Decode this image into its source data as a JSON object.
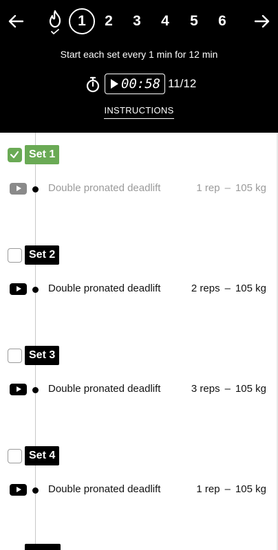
{
  "header": {
    "steps": [
      "1",
      "2",
      "3",
      "4",
      "5",
      "6"
    ],
    "active_step": "1",
    "subtitle": "Start each set every 1 min for 12 min",
    "timer": "00:58",
    "round_count": "11/12",
    "instructions_label": "INSTRUCTIONS"
  },
  "sets": [
    {
      "label": "Set 1",
      "completed": true,
      "exercise": "Double pronated deadlift",
      "reps": "1 rep",
      "weight": "105 kg"
    },
    {
      "label": "Set 2",
      "completed": false,
      "exercise": "Double pronated deadlift",
      "reps": "2 reps",
      "weight": "105 kg"
    },
    {
      "label": "Set 3",
      "completed": false,
      "exercise": "Double pronated deadlift",
      "reps": "3 reps",
      "weight": "105 kg"
    },
    {
      "label": "Set 4",
      "completed": false,
      "exercise": "Double pronated deadlift",
      "reps": "1 rep",
      "weight": "105 kg"
    }
  ],
  "separator": "–",
  "colors": {
    "header_bg": "#000000",
    "done_green": "#6aaa55",
    "done_text": "#9a9a9a"
  },
  "icons": [
    "back-arrow-icon",
    "flame-check-icon",
    "forward-arrow-icon",
    "stopwatch-icon",
    "play-icon",
    "video-icon",
    "check-icon"
  ]
}
